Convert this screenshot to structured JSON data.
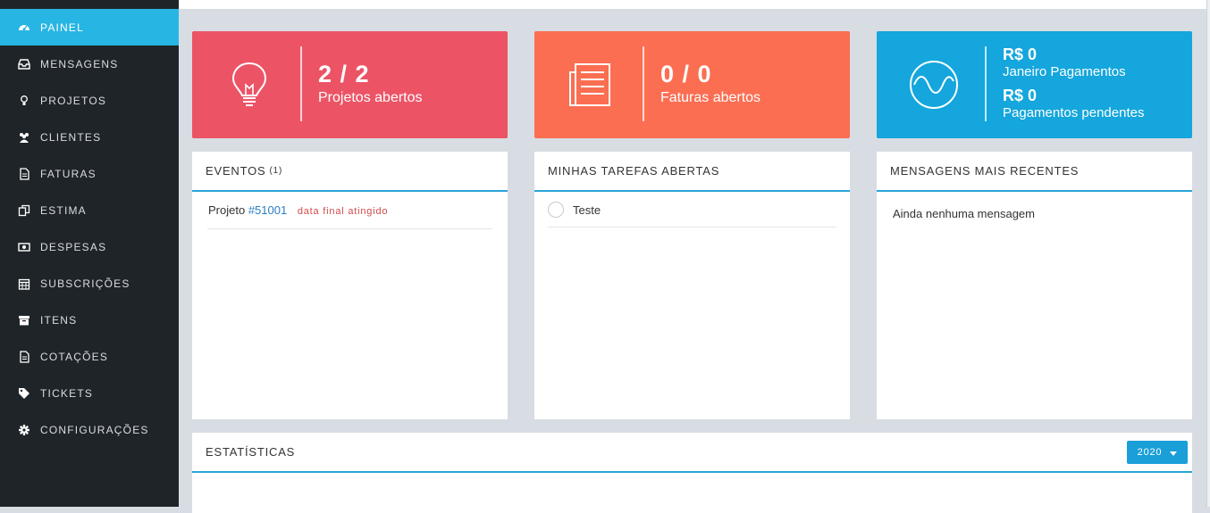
{
  "sidebar": {
    "items": [
      {
        "label": "PAINEL",
        "icon": "dashboard-icon",
        "active": true
      },
      {
        "label": "MENSAGENS",
        "icon": "inbox-icon"
      },
      {
        "label": "PROJETOS",
        "icon": "lightbulb-icon"
      },
      {
        "label": "CLIENTES",
        "icon": "users-icon"
      },
      {
        "label": "FATURAS",
        "icon": "file-icon"
      },
      {
        "label": "ESTIMA",
        "icon": "copy-icon"
      },
      {
        "label": "DESPESAS",
        "icon": "money-icon"
      },
      {
        "label": "SUBSCRIÇÕES",
        "icon": "calendar-icon"
      },
      {
        "label": "ITENS",
        "icon": "archive-icon"
      },
      {
        "label": "COTAÇÕES",
        "icon": "document-icon"
      },
      {
        "label": "TICKETS",
        "icon": "tag-icon"
      },
      {
        "label": "CONFIGURAÇÕES",
        "icon": "gear-icon"
      }
    ]
  },
  "cards": {
    "projects": {
      "value": "2 / 2",
      "label": "Projetos abertos",
      "color": "#ec5466",
      "icon": "lightbulb-icon"
    },
    "invoices": {
      "value": "0 / 0",
      "label": "Faturas abertos",
      "color": "#fb6e52",
      "icon": "invoice-icon"
    },
    "payments": {
      "value1": "R$ 0",
      "label1": "Janeiro Pagamentos",
      "value2": "R$ 0",
      "label2": "Pagamentos pendentes",
      "color": "#14a6dc",
      "icon": "wave-icon"
    }
  },
  "events": {
    "title": "EVENTOS",
    "count": "(1)",
    "items": [
      {
        "prefix": "Projeto",
        "link": "#51001",
        "tag": "data final atingido"
      }
    ]
  },
  "tasks": {
    "title": "MINHAS TAREFAS ABERTAS",
    "items": [
      {
        "label": "Teste"
      }
    ]
  },
  "messages": {
    "title": "MENSAGENS MAIS RECENTES",
    "empty": "Ainda nenhuma mensagem"
  },
  "stats": {
    "title": "ESTATÍSTICAS",
    "year": "2020"
  }
}
